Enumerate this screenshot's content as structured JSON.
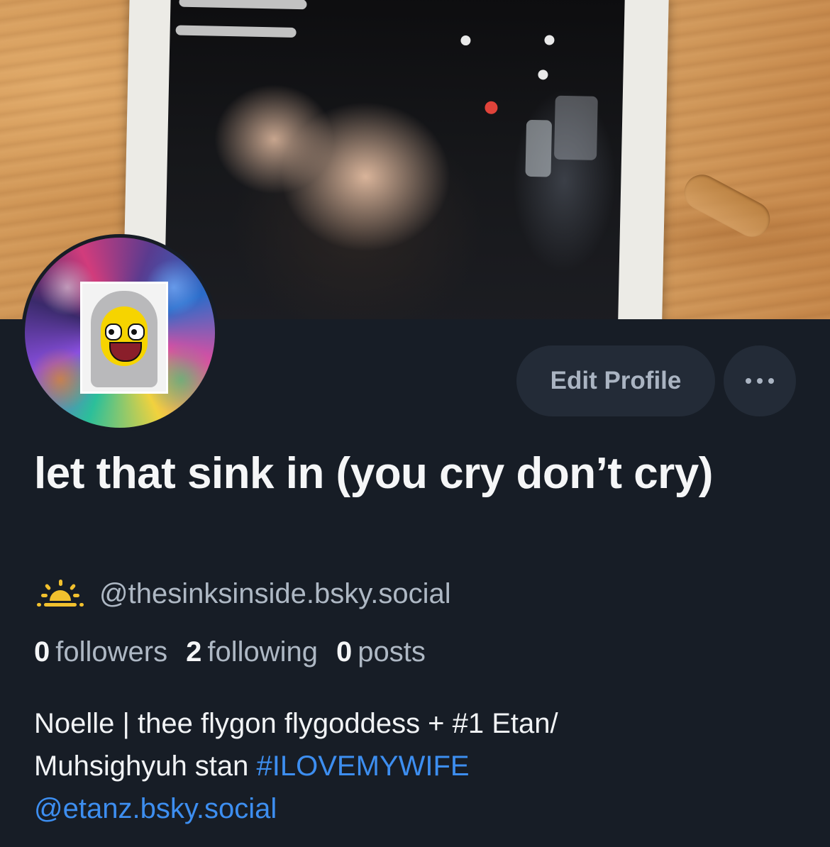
{
  "profile": {
    "display_name": "let that sink in (you cry don’t cry)",
    "handle": "@thesinksinside.bsky.social",
    "icon": "sunrise-icon",
    "accent_color": "#3d8ef0",
    "status_icon_color": "#f2c12e"
  },
  "actions": {
    "edit_profile_label": "Edit Profile",
    "more_icon": "ellipsis-icon"
  },
  "stats": {
    "followers_count": "0",
    "followers_label": "followers",
    "following_count": "2",
    "following_label": "following",
    "posts_count": "0",
    "posts_label": "posts"
  },
  "bio": {
    "line1": "Noelle | thee flygon flygoddess + #1 Etan/",
    "line2_text": "Muhsighyuh stan ",
    "hashtag": "#ILOVEMYWIFE",
    "mention": "@etanz.bsky.social"
  }
}
